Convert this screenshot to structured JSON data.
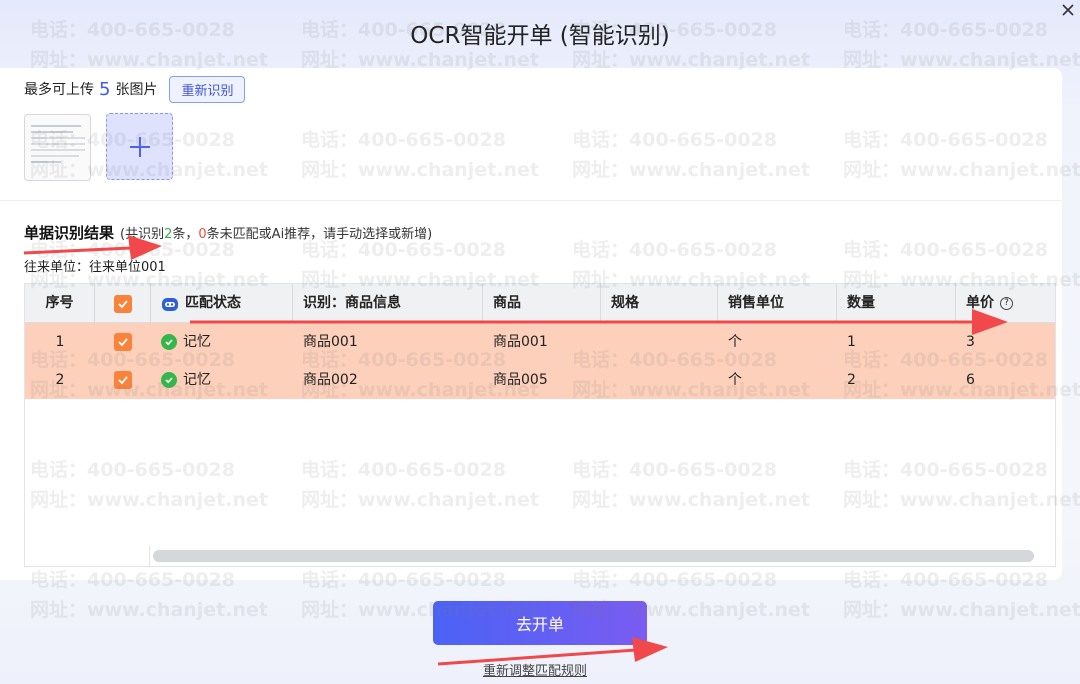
{
  "window": {
    "title": "OCR智能开单 (智能识别)",
    "close_icon": "close-icon"
  },
  "upload": {
    "prefix": "最多可上传",
    "count": "5",
    "suffix": "张图片",
    "reocr_label": "重新识别",
    "add_icon": "plus-icon"
  },
  "result": {
    "title": "单据识别结果",
    "summary_prefix": "(共识别",
    "recognized_count": "2",
    "summary_mid": "条，",
    "unmatched_count": "0",
    "summary_suffix": "条未匹配或Ai推荐，请手动选择或新增)",
    "partner": "往来单位：往来单位001"
  },
  "table": {
    "headers": {
      "seq": "序号",
      "status": "匹配状态",
      "ocr_info": "识别：商品信息",
      "product": "商品",
      "spec": "规格",
      "unit": "销售单位",
      "qty": "数量",
      "price": "单价"
    },
    "help_glyph": "?",
    "rows": [
      {
        "seq": "1",
        "checked": true,
        "status": "记忆",
        "ocr_info": "商品001",
        "product": "商品001",
        "spec": "",
        "unit": "个",
        "qty": "1",
        "price": "3"
      },
      {
        "seq": "2",
        "checked": true,
        "status": "记忆",
        "ocr_info": "商品002",
        "product": "商品005",
        "spec": "",
        "unit": "个",
        "qty": "2",
        "price": "6"
      }
    ]
  },
  "footer": {
    "go_label": "去开单",
    "readjust_label": "重新调整匹配规则"
  },
  "watermark": {
    "phone": "电话：400-665-0028",
    "site": "网址：www.chanjet.net"
  },
  "colors": {
    "accent": "#3d5af1",
    "row_highlight": "#fcd0bb",
    "checkbox": "#f9833b",
    "success": "#35b54a",
    "arrow": "#f0484b"
  }
}
